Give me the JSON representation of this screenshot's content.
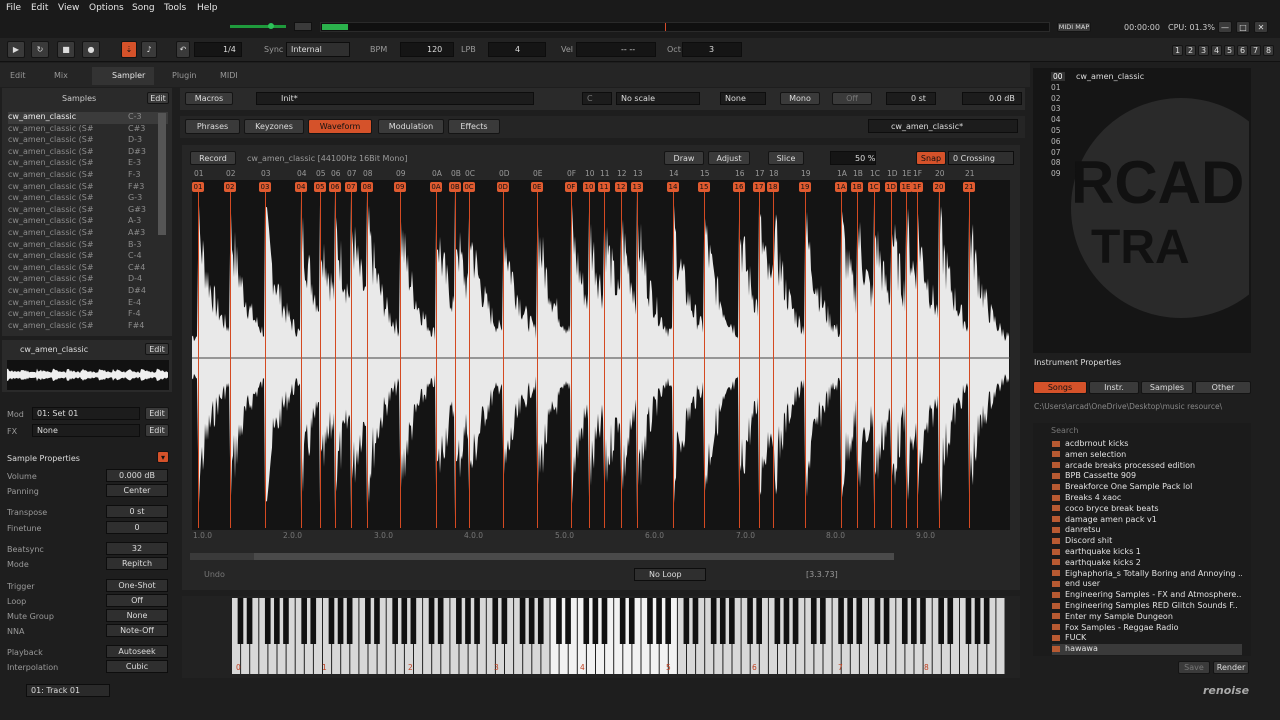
{
  "menu": [
    "File",
    "Edit",
    "View",
    "Options",
    "Song",
    "Tools",
    "Help"
  ],
  "top_right": {
    "midi_map": "MIDI MAP",
    "time": "00:00:00",
    "cpu": "CPU: 01.3%"
  },
  "transport": {
    "pattern": "1/4",
    "sync_label": "Sync",
    "sync_value": "Internal",
    "bpm_label": "BPM",
    "bpm": "120",
    "lpb_label": "LPB",
    "lpb": "4",
    "vel_label": "Vel",
    "vel_value": "-- --",
    "oct_label": "Oct",
    "oct": "3"
  },
  "track_tabs": [
    "1",
    "2",
    "3",
    "4",
    "5",
    "6",
    "7",
    "8"
  ],
  "tabs": {
    "edit": "Edit",
    "mix": "Mix",
    "sampler": "Sampler",
    "plugin": "Plugin",
    "midi": "MIDI"
  },
  "samples_panel": {
    "title": "Samples",
    "edit": "Edit",
    "items": [
      {
        "name": "cw_amen_classic",
        "note": "C-3"
      },
      {
        "name": "cw_amen_classic (S#",
        "note": "C#3"
      },
      {
        "name": "cw_amen_classic (S#",
        "note": "D-3"
      },
      {
        "name": "cw_amen_classic (S#",
        "note": "D#3"
      },
      {
        "name": "cw_amen_classic (S#",
        "note": "E-3"
      },
      {
        "name": "cw_amen_classic (S#",
        "note": "F-3"
      },
      {
        "name": "cw_amen_classic (S#",
        "note": "F#3"
      },
      {
        "name": "cw_amen_classic (S#",
        "note": "G-3"
      },
      {
        "name": "cw_amen_classic (S#",
        "note": "G#3"
      },
      {
        "name": "cw_amen_classic (S#",
        "note": "A-3"
      },
      {
        "name": "cw_amen_classic (S#",
        "note": "A#3"
      },
      {
        "name": "cw_amen_classic (S#",
        "note": "B-3"
      },
      {
        "name": "cw_amen_classic (S#",
        "note": "C-4"
      },
      {
        "name": "cw_amen_classic (S#",
        "note": "C#4"
      },
      {
        "name": "cw_amen_classic (S#",
        "note": "D-4"
      },
      {
        "name": "cw_amen_classic (S#",
        "note": "D#4"
      },
      {
        "name": "cw_amen_classic (S#",
        "note": "E-4"
      },
      {
        "name": "cw_amen_classic (S#",
        "note": "F-4"
      },
      {
        "name": "cw_amen_classic (S#",
        "note": "F#4"
      }
    ]
  },
  "preview": {
    "name": "cw_amen_classic",
    "edit": "Edit"
  },
  "mod": {
    "label": "Mod",
    "value": "01: Set 01",
    "edit": "Edit"
  },
  "fx": {
    "label": "FX",
    "value": "None",
    "edit": "Edit"
  },
  "sample_props": {
    "title": "Sample Properties",
    "rows": [
      {
        "label": "Volume",
        "value": "0.000 dB"
      },
      {
        "label": "Panning",
        "value": "Center"
      },
      {
        "label": "Transpose",
        "value": "0 st"
      },
      {
        "label": "Finetune",
        "value": "0"
      },
      {
        "label": "Beatsync",
        "value": "32"
      },
      {
        "label": "Mode",
        "value": "Repitch"
      },
      {
        "label": "Trigger",
        "value": "One-Shot"
      },
      {
        "label": "Loop",
        "value": "Off"
      },
      {
        "label": "Mute Group",
        "value": "None"
      },
      {
        "label": "NNA",
        "value": "Note-Off"
      },
      {
        "label": "Playback",
        "value": "Autoseek"
      },
      {
        "label": "Interpolation",
        "value": "Cubic"
      }
    ]
  },
  "track_select": "01: Track 01",
  "macros": {
    "label": "Macros",
    "preset": "Init*",
    "key": "C",
    "scale": "No scale",
    "none": "None",
    "mono": "Mono",
    "off": "Off",
    "st": "0 st",
    "db": "0.0 dB"
  },
  "subtabs": {
    "phrases": "Phrases",
    "keyzones": "Keyzones",
    "waveform": "Waveform",
    "modulation": "Modulation",
    "effects": "Effects",
    "instrument": "cw_amen_classic*"
  },
  "wave": {
    "record": "Record",
    "info": "cw_amen_classic [44100Hz 16Bit Mono]",
    "draw": "Draw",
    "adjust": "Adjust",
    "slice": "Slice",
    "zoom": "50 %",
    "snap": "Snap",
    "crossing": "0 Crossing"
  },
  "slice_hex": [
    "01",
    "02",
    "03",
    "04",
    "05",
    "06",
    "07",
    "08",
    "09",
    "0A",
    "0B",
    "0C",
    "0D",
    "0E",
    "0F",
    "10",
    "11",
    "12",
    "13",
    "14",
    "15",
    "16",
    "17",
    "18",
    "19",
    "1A",
    "1B",
    "1C",
    "1D",
    "1E",
    "1F",
    "20",
    "21"
  ],
  "slice_tags": [
    "01",
    "02",
    "03",
    "04",
    "05",
    "06",
    "07",
    "08",
    "09",
    "0A",
    "0B",
    "0C",
    "0D",
    "0E",
    "0F",
    "10",
    "11",
    "12",
    "13",
    "14",
    "15",
    "16",
    "17",
    "18",
    "19",
    "1A",
    "1B",
    "1C",
    "1D",
    "1E",
    "1F",
    "20",
    "21"
  ],
  "ticks": [
    "1.0.0",
    "2.0.0",
    "3.0.0",
    "4.0.0",
    "5.0.0",
    "6.0.0",
    "7.0.0",
    "8.0.0",
    "9.0.0"
  ],
  "bottom_bar": {
    "undo": "Undo",
    "loop": "No Loop",
    "pos": "[3.3.73]"
  },
  "octaves": [
    "0",
    "1",
    "2",
    "3",
    "4",
    "5",
    "6",
    "7",
    "8"
  ],
  "instruments": {
    "items": [
      "00",
      "01",
      "02",
      "03",
      "04",
      "05",
      "06",
      "07",
      "08",
      "09"
    ],
    "selected": "cw_amen_classic"
  },
  "inst_props": "Instrument Properties",
  "browser": {
    "tabs": [
      "Songs",
      "Instr.",
      "Samples",
      "Other"
    ],
    "path": "C:\\Users\\arcad\\OneDrive\\Desktop\\music resource\\",
    "search": "Search",
    "items": [
      "acdbrnout kicks",
      "amen selection",
      "arcade breaks processed edition",
      "BPB Cassette 909",
      "Breakforce One Sample Pack lol",
      "Breaks 4 xaoc",
      "coco bryce break beats",
      "damage amen pack v1",
      "danretsu",
      "Discord shit",
      "earthquake kicks 1",
      "earthquake kicks 2",
      "Eighaphoria_s Totally Boring and Annoying ..",
      "end user",
      "Engineering Samples - FX and Atmosphere..",
      "Engineering Samples RED Glitch Sounds F..",
      "Enter my Sample Dungeon",
      "Fox Samples - Reggae Radio",
      "FUCK",
      "hawawa"
    ],
    "save": "Save",
    "render": "Render"
  },
  "logo": "renoise"
}
